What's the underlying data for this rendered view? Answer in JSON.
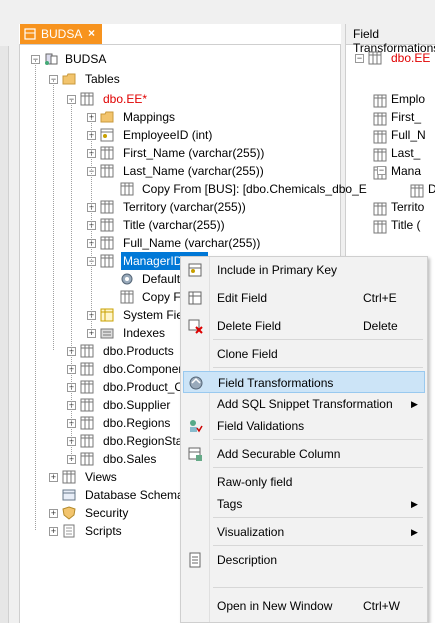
{
  "tab": {
    "label": "BUDSA",
    "close": "×"
  },
  "right_panel": {
    "title": "Field Transformations",
    "table": "dbo.EE",
    "items": [
      "Emplo",
      "First_",
      "Full_N",
      "Last_",
      "Mana",
      "D",
      "Territo",
      "Title ("
    ]
  },
  "tree": {
    "root": "BUDSA",
    "tables": "Tables",
    "ee": "dbo.EE*",
    "mappings": "Mappings",
    "employeeid": "EmployeeID (int)",
    "first_name": "First_Name (varchar(255))",
    "last_name": "Last_Name (varchar(255))",
    "copy_from": "Copy From [BUS]: [dbo.Chemicals_dbo_E",
    "territory": "Territory (varchar(255))",
    "title": "Title (varchar(255))",
    "full_name": "Full_Name (varchar(255))",
    "managerid": "ManagerID (int)",
    "default": "Default t",
    "copy_fro": "Copy Fro",
    "system_fields": "System Field",
    "indexes": "Indexes",
    "products": "dbo.Products",
    "components": "dbo.Components",
    "product_co": "dbo.Product_Co",
    "supplier": "dbo.Supplier",
    "regions": "dbo.Regions",
    "regionstate": "dbo.RegionState",
    "sales": "dbo.Sales",
    "views": "Views",
    "db_schemas": "Database Schemas",
    "security": "Security",
    "scripts": "Scripts"
  },
  "menu": {
    "include_pk": "Include in Primary Key",
    "edit_field": "Edit Field",
    "edit_sc": "Ctrl+E",
    "delete_field": "Delete Field",
    "delete_sc": "Delete",
    "clone_field": "Clone Field",
    "field_transformations": "Field Transformations",
    "add_sql": "Add SQL Snippet Transformation",
    "field_validations": "Field Validations",
    "add_secure": "Add Securable Column",
    "raw_only": "Raw-only field",
    "tags": "Tags",
    "visualization": "Visualization",
    "description": "Description",
    "open_new": "Open in New Window",
    "open_sc": "Ctrl+W"
  },
  "colors": {
    "tab": "#f7931e",
    "selection": "#0078d7",
    "highlight": "#cce4f7",
    "red_text": "#e00000"
  }
}
